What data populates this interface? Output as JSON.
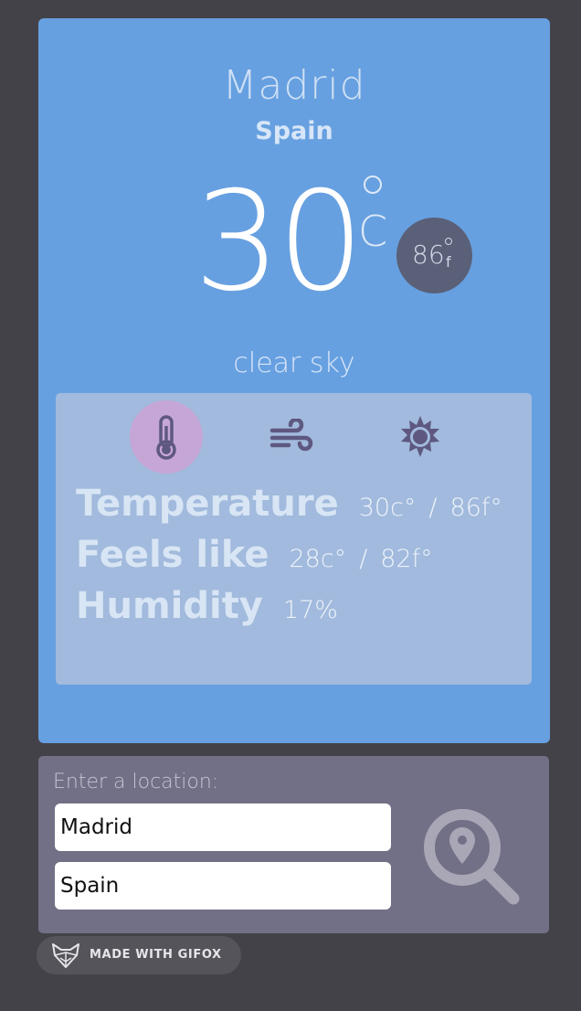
{
  "weather": {
    "city": "Madrid",
    "country": "Spain",
    "temp_c": "30",
    "unit_c": "C",
    "temp_f": "86",
    "unit_f": "f",
    "description": "clear sky"
  },
  "details": {
    "tabs": [
      {
        "icon": "thermometer-icon",
        "active": true
      },
      {
        "icon": "wind-icon",
        "active": false
      },
      {
        "icon": "sun-icon",
        "active": false
      }
    ],
    "rows": [
      {
        "label": "Temperature",
        "value_c": "30c°",
        "separator": "/",
        "value_f": "86f°"
      },
      {
        "label": "Feels like",
        "value_c": "28c°",
        "separator": "/",
        "value_f": "82f°"
      },
      {
        "label": "Humidity",
        "value": "17%"
      }
    ]
  },
  "search": {
    "label": "Enter a location:",
    "city_value": "Madrid",
    "country_value": "Spain",
    "button_icon": "location-search-icon"
  },
  "badge": {
    "text": "MADE WITH GIFOX",
    "icon": "fox-icon"
  },
  "colors": {
    "background": "#444249",
    "card": "#67a0e0",
    "panel": "#a1badd",
    "active_tab": "#c6a6d6",
    "icon": "#5e5880",
    "search_panel": "#727086"
  }
}
